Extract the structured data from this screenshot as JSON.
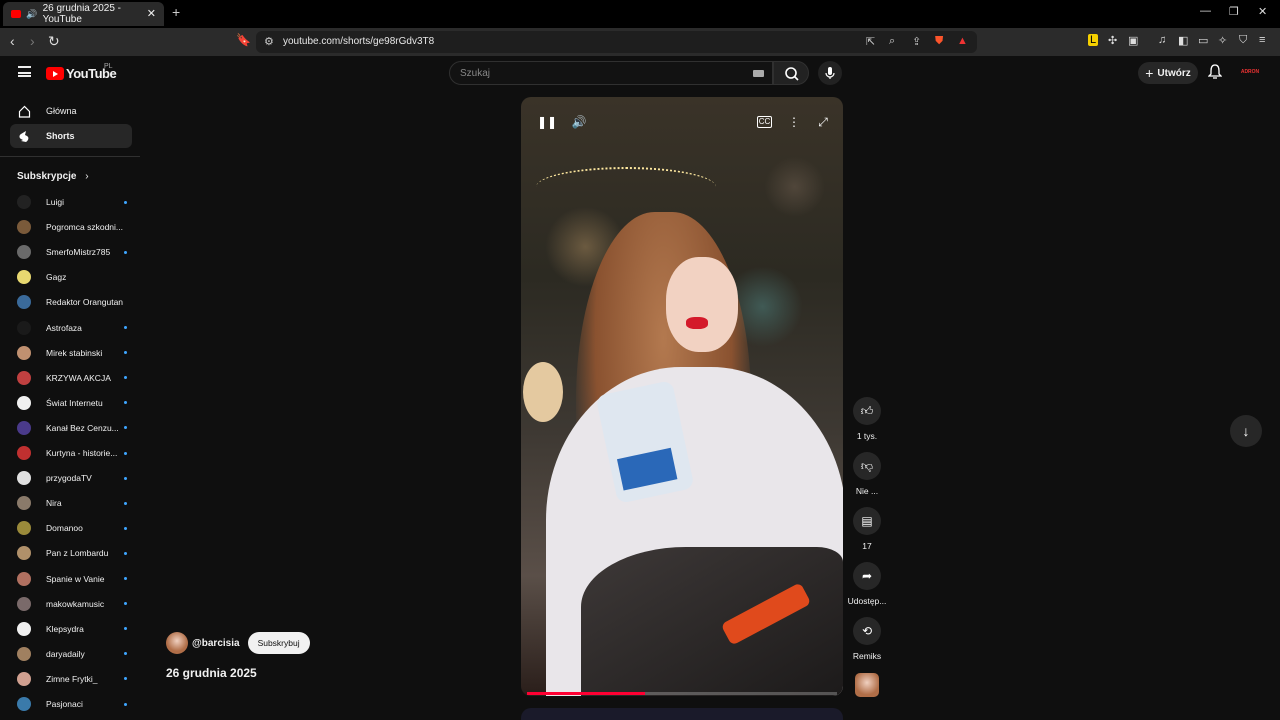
{
  "browser": {
    "tab_title": "26 grudnia 2025 - YouTube",
    "tab_close": "✕",
    "new_tab": "+",
    "url": "youtube.com/shorts/ge98rGdv3T8"
  },
  "header": {
    "logo_text": "YouTube",
    "region": "PL",
    "search_placeholder": "Szukaj",
    "create_label": "Utwórz",
    "account_label": "ADRON"
  },
  "sidebar": {
    "home_label": "Główna",
    "shorts_label": "Shorts",
    "subscriptions_heading": "Subskrypcje",
    "subscriptions": [
      {
        "name": "Luigi",
        "color": "#222222",
        "new": true
      },
      {
        "name": "Pogromca szkodni...",
        "color": "#7a5a3a",
        "new": false
      },
      {
        "name": "SmerfoMistrz785",
        "color": "#6a6a6a",
        "new": true
      },
      {
        "name": "Gagz",
        "color": "#e8d870",
        "new": false
      },
      {
        "name": "Redaktor Orangutan",
        "color": "#3a6a9a",
        "new": false
      },
      {
        "name": "Astrofaza",
        "color": "#1a1a1a",
        "new": true
      },
      {
        "name": "Mirek stabinski",
        "color": "#c09070",
        "new": true
      },
      {
        "name": "KRZYWA AKCJA",
        "color": "#c04040",
        "new": true
      },
      {
        "name": "Świat Internetu",
        "color": "#f0f0f0",
        "new": true
      },
      {
        "name": "Kanał Bez Cenzu...",
        "color": "#4a3a8a",
        "new": true
      },
      {
        "name": "Kurtyna - historie...",
        "color": "#c03030",
        "new": true
      },
      {
        "name": "przygodaTV",
        "color": "#e0e0e0",
        "new": true
      },
      {
        "name": "Nira",
        "color": "#8a7a6a",
        "new": true
      },
      {
        "name": "Domanoo",
        "color": "#9a8a3a",
        "new": true
      },
      {
        "name": "Pan z Lombardu",
        "color": "#b0906a",
        "new": true
      },
      {
        "name": "Spanie w Vanie",
        "color": "#b07060",
        "new": true
      },
      {
        "name": "makowkamusic",
        "color": "#7a6a6a",
        "new": true
      },
      {
        "name": "Klepsydra",
        "color": "#f0f0f0",
        "new": true
      },
      {
        "name": "daryadaily",
        "color": "#a08060",
        "new": true
      },
      {
        "name": "Zimne Frytki_",
        "color": "#d0a090",
        "new": true
      },
      {
        "name": "Pasjonaci",
        "color": "#3a7aaa",
        "new": true
      }
    ]
  },
  "short": {
    "channel": "@barcisia",
    "subscribe_label": "Subskrybuj",
    "title": "26 grudnia 2025",
    "progress": 0.38,
    "likes": "1 tys.",
    "dislike_label": "Nie ...",
    "comments": "17",
    "share_label": "Udostęp...",
    "remix_label": "Remiks"
  },
  "icons": {
    "pause": "pause-icon",
    "volume": "volume-icon",
    "captions": "cc-icon",
    "more": "more-vert-icon",
    "fullscreen": "fullscreen-icon"
  }
}
